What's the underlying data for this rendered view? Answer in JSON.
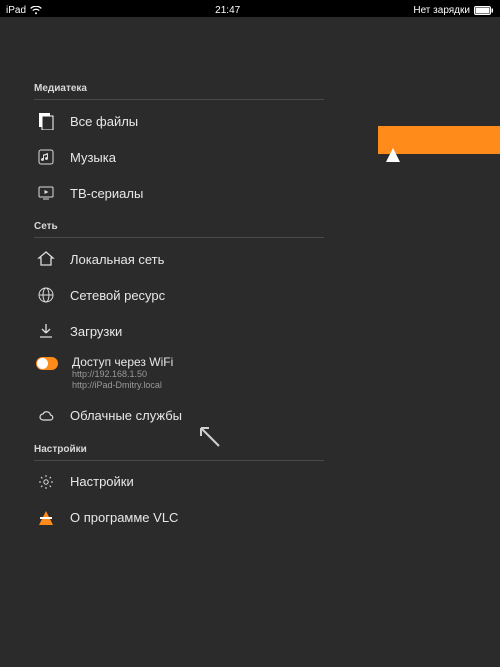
{
  "statusbar": {
    "device": "iPad",
    "time": "21:47",
    "battery_text": "Нет зарядки"
  },
  "sections": {
    "media": "Медиатека",
    "network": "Сеть",
    "settings": "Настройки"
  },
  "items": {
    "all_files": "Все файлы",
    "music": "Музыка",
    "tv": "ТВ-сериалы",
    "lan": "Локальная сеть",
    "netres": "Сетевой ресурс",
    "downloads": "Загрузки",
    "wifi_title": "Доступ через WiFi",
    "wifi_url1": "http://192.168.1.50",
    "wifi_url2": "http://iPad-Dmitry.local",
    "cloud": "Облачные службы",
    "settings": "Настройки",
    "about": "О программе VLC"
  }
}
